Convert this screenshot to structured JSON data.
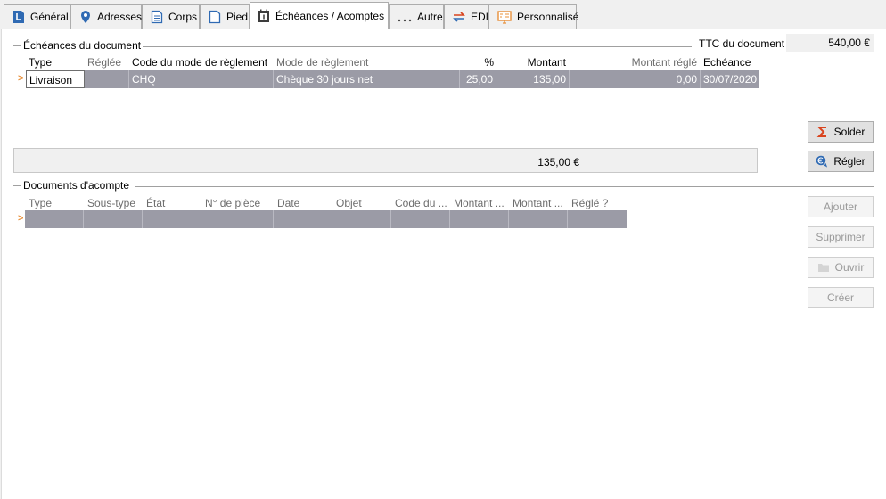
{
  "tabs": [
    {
      "label": "Général",
      "icon": "document-l-icon"
    },
    {
      "label": "Adresses",
      "icon": "map-pin-icon"
    },
    {
      "label": "Corps",
      "icon": "document-lines-icon"
    },
    {
      "label": "Pied",
      "icon": "document-icon"
    },
    {
      "label": "Échéances / Acomptes",
      "icon": "calendar-icon",
      "active": true
    },
    {
      "label": "Autre",
      "icon": "ellipsis-icon"
    },
    {
      "label": "EDI",
      "icon": "exchange-arrows-icon"
    },
    {
      "label": "Personnalisé",
      "icon": "custom-screen-icon"
    }
  ],
  "echeances": {
    "title": "Échéances du document",
    "ttc_label": "TTC du document",
    "ttc_value": "540,00 €",
    "columns": [
      "Type",
      "Réglée",
      "Code du mode de règlement",
      "Mode de règlement",
      "%",
      "Montant",
      "Montant réglé",
      "Echéance"
    ],
    "rows": [
      {
        "type": "Livraison",
        "reglee": "",
        "code": "CHQ",
        "mode": "Chèque 30 jours net",
        "pct": "25,00",
        "montant": "135,00",
        "montant_regle": "0,00",
        "echeance": "30/07/2020"
      }
    ],
    "total": "135,00 €"
  },
  "acomptes": {
    "title": "Documents d'acompte",
    "columns": [
      "Type",
      "Sous-type",
      "État",
      "N° de pièce",
      "Date",
      "Objet",
      "Code du ...",
      "Montant ...",
      "Montant ...",
      "Réglé ?"
    ]
  },
  "buttons": {
    "solder": "Solder",
    "regler": "Régler",
    "ajouter": "Ajouter",
    "supprimer": "Supprimer",
    "ouvrir": "Ouvrir",
    "creer": "Créer"
  },
  "colors": {
    "selected_row": "#9b9ba6",
    "row_marker": "#e8903a",
    "sigma": "#d9441e",
    "euro": "#2f6ab3"
  }
}
